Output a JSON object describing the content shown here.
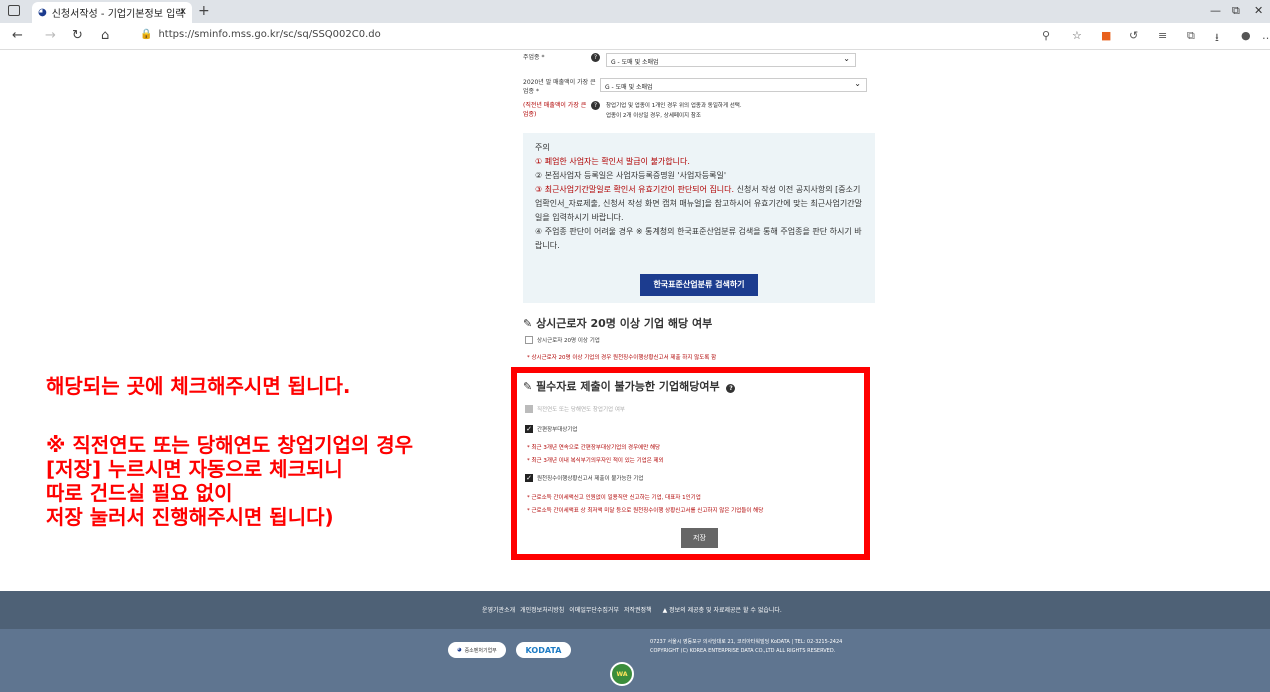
{
  "browser": {
    "tab_title": "신청서작성 - 기업기본정보 입력",
    "tab_close": "x",
    "new_tab": "+",
    "url": "https://sminfo.mss.go.kr/sc/sq/SSQ002C0.do",
    "window_controls": [
      "—",
      "⧉",
      "✕"
    ]
  },
  "form": {
    "main_industry_label": "주업종 *",
    "main_industry_value": "G - 도매 및 소매업",
    "sales_industry_label": "2020년 말 매출액이 가장 큰 업종 *",
    "sales_industry_value": "G - 도매 및 소매업",
    "recent_label": "(직전년 매출액이 가장 큰 업종)",
    "recent_note_1": "창업기업 및 업종이 1개인 경우 위의 업종과 동일하게 선택.",
    "recent_note_2": "업종이 2개 이상일 경우, 상세페이지 참조"
  },
  "notice": {
    "heading": "주의",
    "line1": "① 폐업한 사업자는 확인서 발급이 불가합니다.",
    "line2": "② 본점사업자 등록일은 사업자등록증명원 '사업자등록일'",
    "line3_red": "③ 최근사업기간말일로 확인서 유효기간이 판단되어 집니다.",
    "line3_rest": " 신청서 작성 이전 공지사항의 [중소기업확인서_자료제출, 신청서 작성 화면 캡쳐 매뉴얼]을 참고하시어 유효기간에 맞는 최근사업기간말일을 입력하시기 바랍니다.",
    "line4": "④ 주업종 판단이 어려울 경우 ※ 통계청의 한국표준산업분류 검색을 통해 주업종을 판단 하시기 바랍니다.",
    "button": "한국표준산업분류 검색하기"
  },
  "section_employee": {
    "title": "상시근로자 20명 이상 기업 해당 여부",
    "checkbox_label": "상시근로자 20명 이상 기업",
    "note": "* 상시근로자 20명 이상 기업의 경우 원천징수이행상황신고서 제출 하지 않도록 함"
  },
  "section_required": {
    "title": "필수자료 제출이 불가능한 기업해당여부",
    "cb1": "직전연도 또는 당해연도 창업기업 여부",
    "cb2": "간편장부대상기업",
    "cb2_note1": "* 최근 3개년 연속으로 간편장부대상기업의 경우에만 해당",
    "cb2_note2": "* 최근 3개년 이내 복식부기의무자인 적이 있는 기업은 제외",
    "cb3": "원천징수이행상황신고서 제출이 불가능한 기업",
    "cb3_note1": "* 근로소득 간이세액신고 인원없이 일용직만 신고하는 기업, 대표자 1인기업",
    "cb3_note2": "* 근로소득 간이세액표 상 최저액 미달 등으로 원천징수이행 상황신고서를 신고하지 않은 기업들이 해당",
    "save": "저장"
  },
  "annotation": {
    "line1": "해당되는 곳에 체크해주시면 됩니다.",
    "line2": "※ 직전연도 또는 당해연도 창업기업의 경우",
    "line3": "[저장] 누르시면 자동으로 체크되니",
    "line4": "따로 건드실 필요 없이",
    "line5": "저장 눌러서 진행해주시면 됩니다)"
  },
  "footer": {
    "links": [
      "운영기관소개",
      "개인정보처리방침",
      "이메일무단수집거부",
      "저작권정책"
    ],
    "warning": "▲ 정보의 제공충 및 자료제공은 할 수 없습니다.",
    "logo1": "중소벤처기업부",
    "logo2": "KODATA",
    "copy1": "07237 서울시 영등포구 의사당대로 21, 코리아타워빌딩 KoDATA | TEL: 02-3215-2424",
    "copy2": "COPYRIGHT (C) KOREA ENTERPRISE DATA CO.,LTD ALL RIGHTS RESERVED.",
    "wa_mark": "WA"
  },
  "colors": {
    "annotation": "#ff0000",
    "button": "#1c3c8f",
    "footer": "#4e6176"
  }
}
